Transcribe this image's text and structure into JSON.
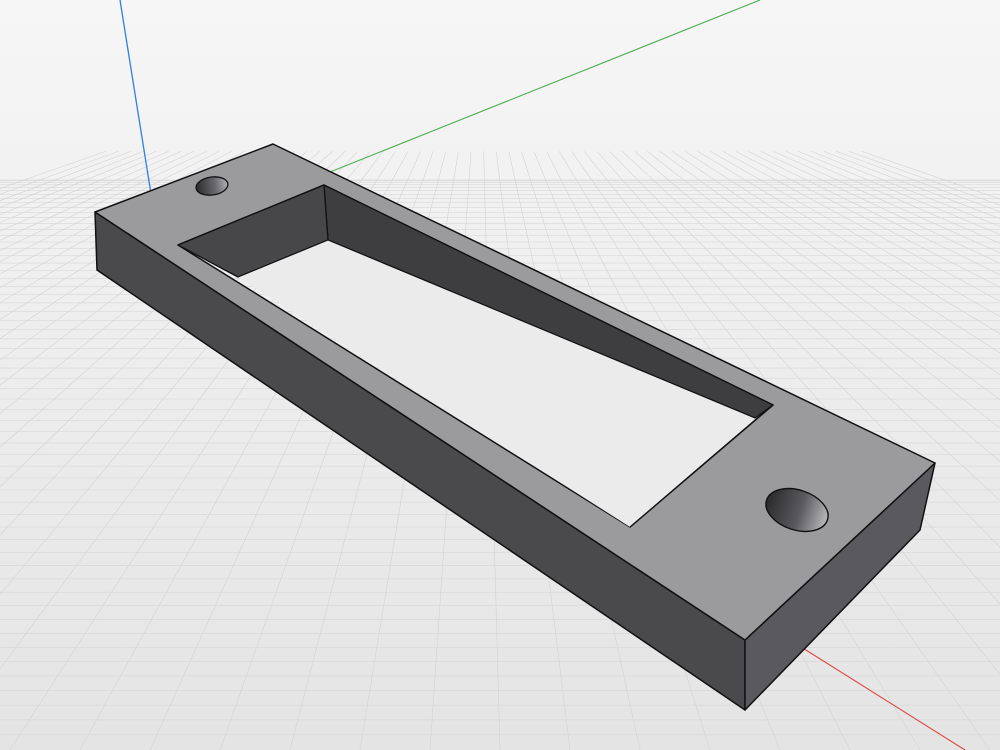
{
  "viewport": {
    "background_top": "#f6f6f6",
    "background_bottom": "#e4e4e4",
    "grid_color": "#d2d2d2"
  },
  "axes": {
    "x_color": "#e0463c",
    "y_color": "#4caf50",
    "z_color": "#2f7fe8"
  },
  "model": {
    "name": "",
    "top_face_color": "#9b9b9e",
    "side_face_color": "#4a4a4d",
    "end_face_color": "#5a5a5e",
    "edge_color": "#111111",
    "hole_count": 2
  }
}
